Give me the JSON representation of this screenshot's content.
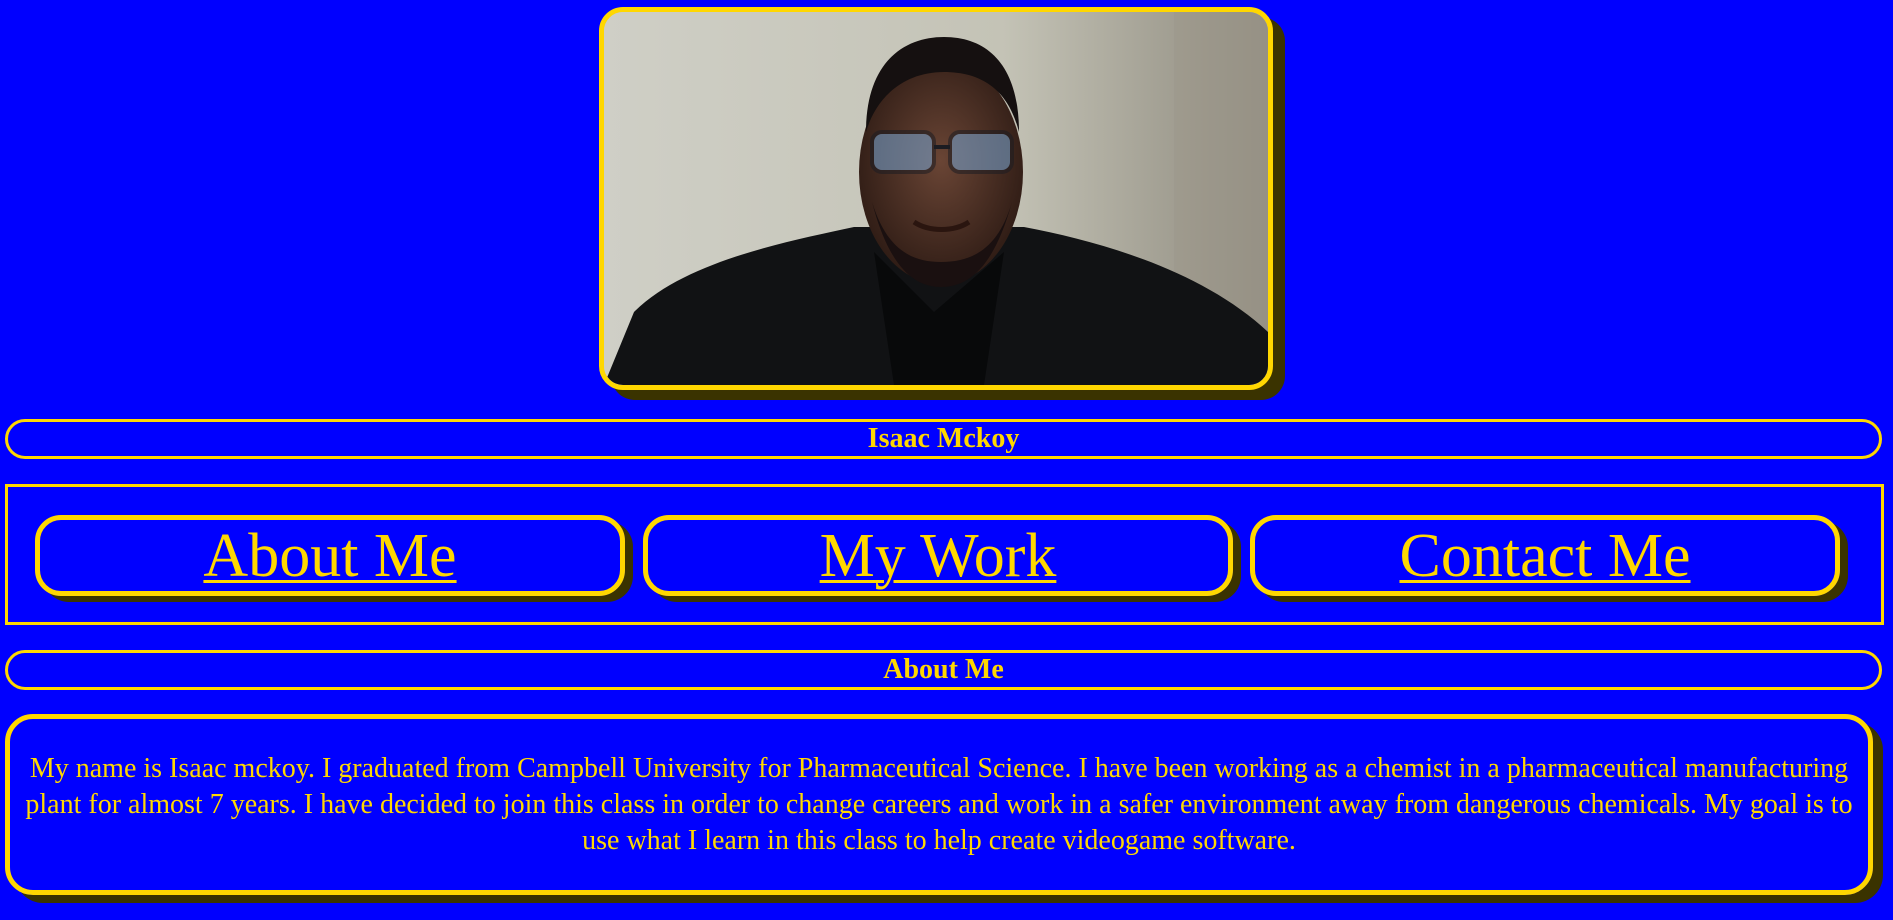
{
  "profile": {
    "photo_alt": "Isaac Mckoy",
    "name": "Isaac Mckoy"
  },
  "nav": {
    "items": [
      {
        "label": "About Me"
      },
      {
        "label": "My Work"
      },
      {
        "label": "Contact Me"
      }
    ]
  },
  "about": {
    "heading": "About Me",
    "text": "My name is Isaac mckoy. I graduated from Campbell University for Pharmaceutical Science. I have been working as a chemist in a pharmaceutical manufacturing plant for almost 7 years. I have decided to join this class in order to change careers and work in a safer environment away from dangerous chemicals. My goal is to use what I learn in this class to help create videogame software."
  },
  "colors": {
    "background": "#0000ff",
    "accent": "#ffd700",
    "shadow": "#3a3300"
  }
}
